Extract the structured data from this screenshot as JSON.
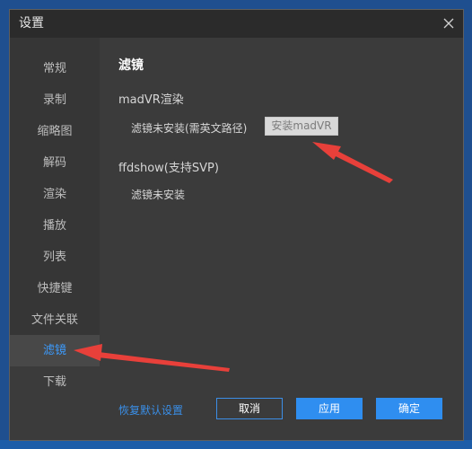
{
  "dialog": {
    "title": "设置",
    "icons": {
      "close": "close-icon"
    }
  },
  "sidebar": {
    "items": [
      {
        "label": "常规"
      },
      {
        "label": "录制"
      },
      {
        "label": "缩略图"
      },
      {
        "label": "解码"
      },
      {
        "label": "渲染"
      },
      {
        "label": "播放"
      },
      {
        "label": "列表"
      },
      {
        "label": "快捷键"
      },
      {
        "label": "文件关联"
      },
      {
        "label": "滤镜",
        "active": true
      },
      {
        "label": "下载"
      }
    ]
  },
  "content": {
    "section_title": "滤镜",
    "madvr": {
      "title": "madVR渲染",
      "status": "滤镜未安装(需英文路径)",
      "install_button": "安装madVR"
    },
    "ffdshow": {
      "title": "ffdshow(支持SVP)",
      "status": "滤镜未安装"
    }
  },
  "footer": {
    "restore_defaults": "恢复默认设置",
    "cancel": "取消",
    "apply": "应用",
    "ok": "确定"
  },
  "colors": {
    "accent": "#2f8ef0",
    "annotation_arrow": "#e8403a"
  }
}
